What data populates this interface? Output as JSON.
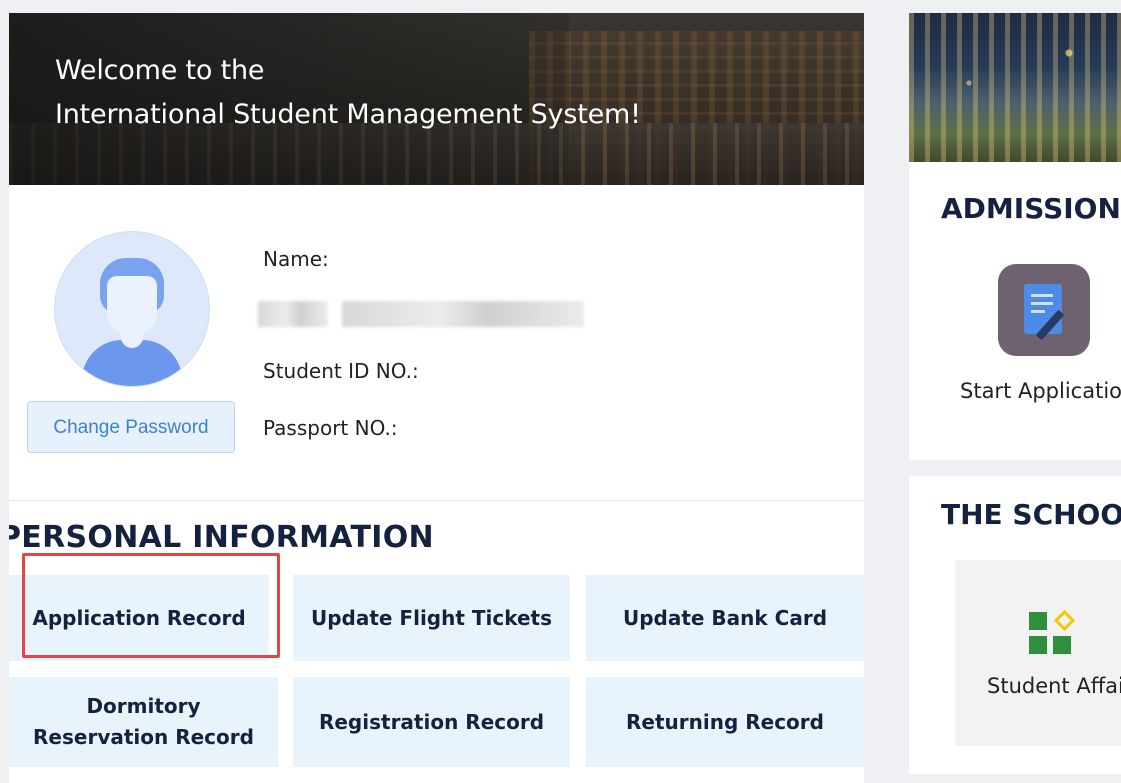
{
  "banner": {
    "welcome_line1": "Welcome to the",
    "welcome_line2": "International Student Management System!"
  },
  "profile": {
    "name_label": "Name:",
    "student_id_label": "Student ID NO.:",
    "passport_label": "Passport NO.:",
    "change_password_label": "Change Password"
  },
  "personal_info": {
    "title": "PERSONAL INFORMATION",
    "tiles": [
      {
        "label": "Application Record"
      },
      {
        "label": "Update Flight Tickets"
      },
      {
        "label": "Update Bank Card"
      },
      {
        "label": "Dormitory Reservation Record"
      },
      {
        "label": "Registration Record"
      },
      {
        "label": "Returning Record"
      }
    ],
    "highlighted": "Application Record"
  },
  "admissions": {
    "title": "ADMISSIONS",
    "item_label": "Start Application",
    "icon": "document-edit-icon"
  },
  "school": {
    "title": "THE SCHOOL",
    "item_label": "Student Affairs",
    "icon": "apps-grid-icon"
  },
  "colors": {
    "accent_text": "#14223f",
    "tile_bg": "#e9f3fb",
    "highlight": "#e04848",
    "button_text": "#3d82cf"
  }
}
